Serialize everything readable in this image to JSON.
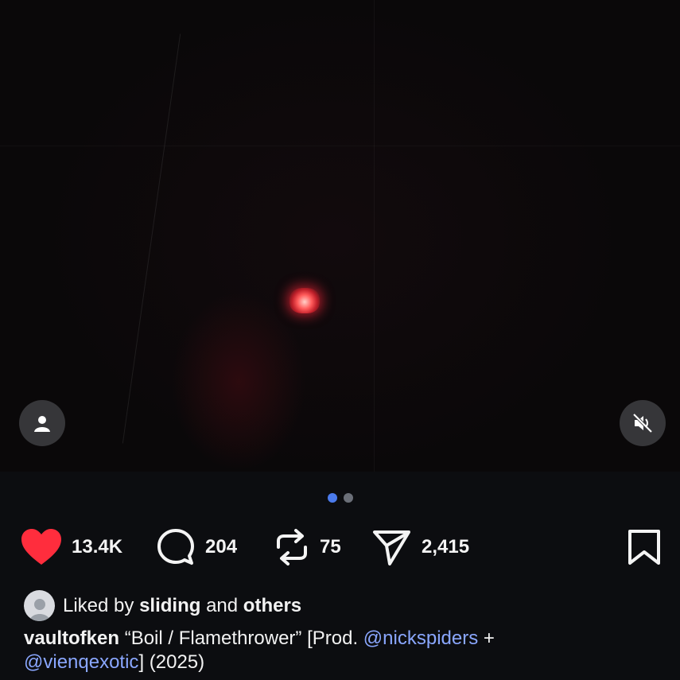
{
  "post": {
    "media_count": 2,
    "active_media_index": 0
  },
  "colors": {
    "like": "#ff2d3d",
    "dot_active": "#4b7bec",
    "dot_inactive": "#6b6f78",
    "mention": "#8aa7ff"
  },
  "actions": {
    "likes": "13.4K",
    "comments": "204",
    "reposts": "75",
    "shares": "2,415"
  },
  "liked_by": {
    "prefix": "Liked by",
    "user": "sliding",
    "conjunction": "and",
    "others": "others"
  },
  "caption": {
    "username": "vaultofken",
    "text_1": "“Boil / Flamethrower” [Prod.",
    "mention_1": "@nickspiders",
    "plus": "+",
    "mention_2": "@vienqexotic",
    "text_2": "] (2025)"
  },
  "icons": [
    "user-icon",
    "muted-speaker-icon",
    "heart-icon",
    "comment-icon",
    "repost-icon",
    "share-icon",
    "bookmark-icon"
  ]
}
